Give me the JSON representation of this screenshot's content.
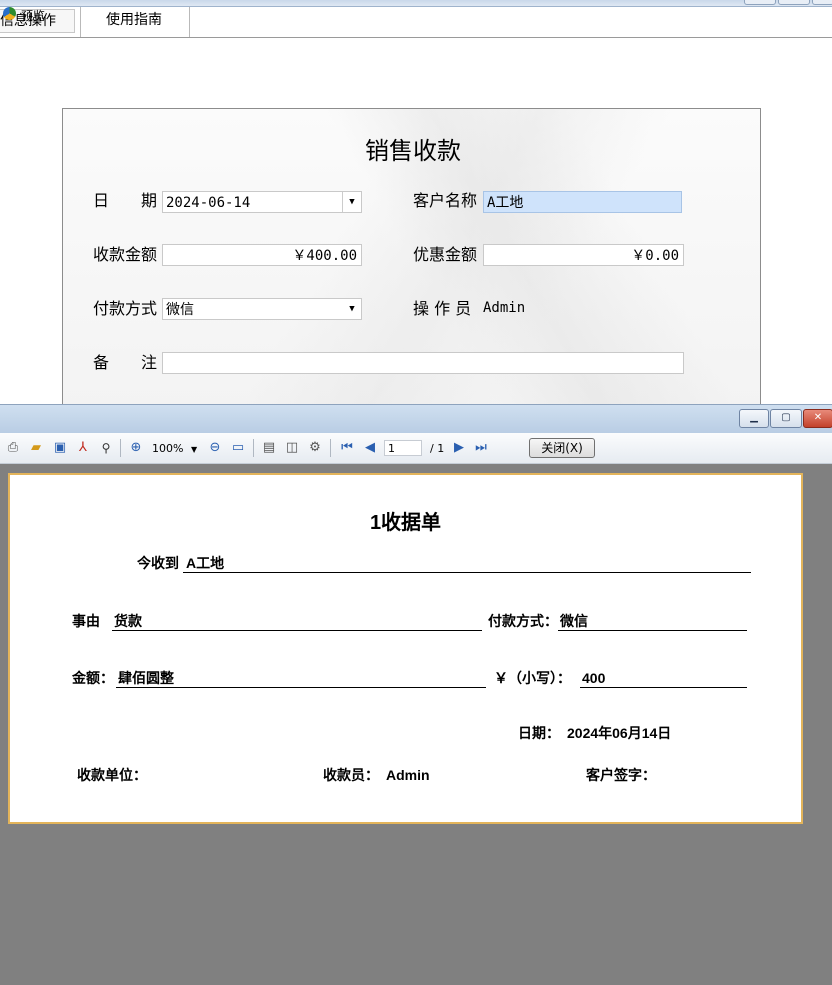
{
  "main_window": {
    "tabs": [
      {
        "label": "信息操作"
      },
      {
        "label": "使用指南"
      }
    ],
    "form": {
      "title": "销售收款",
      "date": {
        "label": "日　　期",
        "value": "2024-06-14"
      },
      "customer": {
        "label": "客户名称",
        "value": "A工地"
      },
      "amount": {
        "label": "收款金额",
        "value": "￥400.00"
      },
      "discount": {
        "label": "优惠金额",
        "value": "￥0.00"
      },
      "payment_method": {
        "label": "付款方式",
        "value": "微信"
      },
      "operator": {
        "label": "操 作 员",
        "value": "Admin"
      },
      "note": {
        "label": "备　　注",
        "value": ""
      }
    }
  },
  "preview_window": {
    "title": "预览",
    "toolbar": {
      "zoom": "100%",
      "page": "1",
      "page_total": "/ 1",
      "close_label": "关闭(X)"
    },
    "receipt": {
      "title": "1收据单",
      "received_from_label": "今收到",
      "received_from_value": "A工地",
      "reason_label": "事由",
      "reason_value": "货款",
      "payment_label": "付款方式：",
      "payment_value": "微信",
      "amount_label": "金额：",
      "amount_words": "肆佰圆整",
      "amount_small_label": "￥（小写）：",
      "amount_small_value": "400",
      "date_label": "日期：",
      "date_value": "2024年06月14日",
      "payee_unit_label": "收款单位：",
      "cashier_label": "收款员：",
      "cashier_value": "Admin",
      "customer_signature_label": "客户签字："
    }
  },
  "colors": {
    "paper_border": "#e3b45a",
    "preview_bg": "#808080",
    "selected_field": "#cfe3fb"
  },
  "icons": [
    "print-icon",
    "open-icon",
    "save-icon",
    "pdf-icon",
    "find-icon",
    "zoom-in-icon",
    "zoom-out-icon",
    "fit-page-icon",
    "single-page-icon",
    "two-page-icon",
    "settings-icon",
    "first-page-icon",
    "prev-page-icon",
    "next-page-icon",
    "last-page-icon",
    "app-icon",
    "minimize-icon",
    "maximize-icon",
    "close-icon"
  ]
}
